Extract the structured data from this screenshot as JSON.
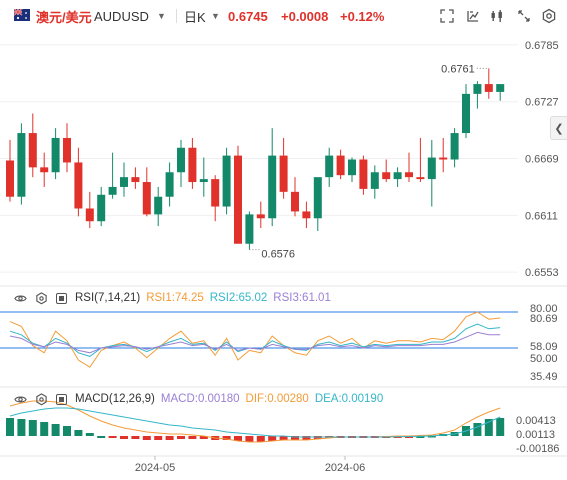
{
  "header": {
    "symbol_cn": "澳元/美元",
    "symbol_en": "AUDUSD",
    "period": "日K",
    "price": "0.6745",
    "change": "+0.0008",
    "change_pct": "+0.12%"
  },
  "colors": {
    "up": "#14896a",
    "down": "#e0312a",
    "rsi1": "#f39c38",
    "rsi2": "#35b6c9",
    "rsi3": "#9b7fd4",
    "macd_line": "#f39c38",
    "dif_line": "#35b6c9",
    "ref_line": "#2a7be4"
  },
  "icons": [
    "dropdown-caret-icon",
    "crosshair-icon",
    "drawing-icon",
    "indicator-icon",
    "fullscreen-icon",
    "settings-icon",
    "eye-icon",
    "gear-icon",
    "collapse-arrow-icon"
  ],
  "price_axis": {
    "labels": [
      "0.6785",
      "0.6727",
      "0.6669",
      "0.6611",
      "0.6553"
    ],
    "ylim": [
      0.6545,
      0.679
    ]
  },
  "annotations": {
    "high": "0.6761",
    "low": "0.6576"
  },
  "rsi": {
    "label": "RSI(7,14,21)",
    "rsi1_label": "RSI1:74.25",
    "rsi2_label": "RSI2:65.02",
    "rsi3_label": "RSI3:61.01",
    "axis_labels": [
      "80.00",
      "80.69",
      "58.09",
      "50.00",
      "35.49"
    ]
  },
  "macd": {
    "label": "MACD(12,26,9)",
    "macd_label": "MACD:0.00180",
    "dif_label": "DIF:0.00280",
    "dea_label": "DEA:0.00190",
    "axis_labels": [
      "0.00413",
      "0.00113",
      "-0.00186"
    ]
  },
  "time_axis": {
    "labels": [
      "2024-05",
      "2024-06"
    ]
  },
  "chart_data": {
    "type": "candlestick",
    "candles": [
      [
        0.6667,
        0.6688,
        0.6625,
        0.663
      ],
      [
        0.663,
        0.6705,
        0.6622,
        0.6695
      ],
      [
        0.6695,
        0.6715,
        0.665,
        0.666
      ],
      [
        0.666,
        0.6675,
        0.664,
        0.6655
      ],
      [
        0.6655,
        0.67,
        0.6648,
        0.669
      ],
      [
        0.669,
        0.6705,
        0.6655,
        0.6665
      ],
      [
        0.6665,
        0.668,
        0.661,
        0.6618
      ],
      [
        0.6618,
        0.6635,
        0.6598,
        0.6605
      ],
      [
        0.6605,
        0.664,
        0.66,
        0.6632
      ],
      [
        0.6632,
        0.6675,
        0.6628,
        0.664
      ],
      [
        0.664,
        0.6665,
        0.663,
        0.665
      ],
      [
        0.665,
        0.666,
        0.6638,
        0.6645
      ],
      [
        0.6645,
        0.666,
        0.661,
        0.6612
      ],
      [
        0.6612,
        0.664,
        0.66,
        0.663
      ],
      [
        0.663,
        0.6665,
        0.662,
        0.6655
      ],
      [
        0.6655,
        0.6688,
        0.664,
        0.668
      ],
      [
        0.668,
        0.669,
        0.6638,
        0.6645
      ],
      [
        0.6645,
        0.667,
        0.663,
        0.6648
      ],
      [
        0.6648,
        0.6652,
        0.6605,
        0.662
      ],
      [
        0.662,
        0.668,
        0.6612,
        0.6672
      ],
      [
        0.6672,
        0.6682,
        0.6598,
        0.6582
      ],
      [
        0.6582,
        0.6615,
        0.6576,
        0.6612
      ],
      [
        0.6612,
        0.6625,
        0.6598,
        0.6608
      ],
      [
        0.6608,
        0.67,
        0.66,
        0.6672
      ],
      [
        0.6672,
        0.669,
        0.6628,
        0.6635
      ],
      [
        0.6635,
        0.665,
        0.661,
        0.6615
      ],
      [
        0.6615,
        0.6625,
        0.6598,
        0.6608
      ],
      [
        0.6608,
        0.6648,
        0.6595,
        0.665
      ],
      [
        0.665,
        0.668,
        0.664,
        0.6672
      ],
      [
        0.6672,
        0.6678,
        0.6648,
        0.6652
      ],
      [
        0.6652,
        0.667,
        0.6645,
        0.6668
      ],
      [
        0.6668,
        0.6672,
        0.6632,
        0.6638
      ],
      [
        0.6638,
        0.6662,
        0.6628,
        0.6655
      ],
      [
        0.6655,
        0.6668,
        0.6645,
        0.6648
      ],
      [
        0.6648,
        0.666,
        0.664,
        0.6655
      ],
      [
        0.6655,
        0.6675,
        0.6645,
        0.665
      ],
      [
        0.665,
        0.669,
        0.6645,
        0.6648
      ],
      [
        0.6648,
        0.6688,
        0.662,
        0.667
      ],
      [
        0.667,
        0.669,
        0.6655,
        0.6668
      ],
      [
        0.6668,
        0.67,
        0.666,
        0.6695
      ],
      [
        0.6695,
        0.6745,
        0.669,
        0.6735
      ],
      [
        0.6735,
        0.6748,
        0.672,
        0.6745
      ],
      [
        0.6745,
        0.6761,
        0.673,
        0.6737
      ],
      [
        0.6737,
        0.6745,
        0.6728,
        0.6745
      ]
    ],
    "rsi1": [
      72,
      68,
      52,
      46,
      64,
      56,
      40,
      34,
      48,
      52,
      55,
      50,
      42,
      50,
      58,
      64,
      54,
      56,
      44,
      58,
      40,
      48,
      46,
      60,
      52,
      46,
      44,
      56,
      60,
      54,
      58,
      50,
      56,
      54,
      56,
      56,
      55,
      58,
      57,
      64,
      76,
      80,
      74,
      75
    ],
    "rsi2": [
      64,
      61,
      54,
      51,
      58,
      54,
      46,
      43,
      50,
      52,
      53,
      51,
      47,
      51,
      55,
      58,
      53,
      54,
      48,
      55,
      47,
      50,
      49,
      56,
      52,
      49,
      48,
      53,
      55,
      52,
      54,
      51,
      53,
      52,
      53,
      53,
      53,
      55,
      55,
      58,
      66,
      70,
      66,
      67
    ],
    "rsi3": [
      60,
      58,
      53,
      51,
      55,
      53,
      48,
      46,
      50,
      51,
      52,
      51,
      49,
      51,
      53,
      55,
      52,
      53,
      49,
      53,
      48,
      50,
      49,
      53,
      51,
      49,
      49,
      52,
      53,
      51,
      52,
      50,
      52,
      51,
      52,
      52,
      52,
      53,
      53,
      55,
      59,
      63,
      61,
      61
    ],
    "macd_hist": [
      0.0018,
      0.0017,
      0.0016,
      0.0014,
      0.0012,
      0.001,
      0.0006,
      0.0003,
      0.0,
      -0.0002,
      -0.0003,
      -0.0003,
      -0.0004,
      -0.0004,
      -0.0004,
      -0.0003,
      -0.0003,
      -0.0003,
      -0.0004,
      -0.0004,
      -0.0005,
      -0.0006,
      -0.0006,
      -0.0005,
      -0.0004,
      -0.0004,
      -0.0004,
      -0.0003,
      -0.0002,
      -0.0001,
      -5e-05,
      -0.0001,
      -0.0001,
      -5e-05,
      -3e-05,
      -2e-05,
      0.0,
      5e-05,
      0.0002,
      0.0004,
      0.001,
      0.0013,
      0.0017,
      0.0018
    ],
    "macd_dif": [
      0.003,
      0.0033,
      0.0035,
      0.0035,
      0.0034,
      0.0031,
      0.0026,
      0.002,
      0.0015,
      0.0011,
      0.0008,
      0.0006,
      0.0004,
      0.0003,
      0.0002,
      0.0002,
      0.0001,
      0.0,
      -0.0002,
      -0.0003,
      -0.0005,
      -0.0006,
      -0.0006,
      -0.0005,
      -0.0004,
      -0.0004,
      -0.0004,
      -0.0003,
      -0.0002,
      -0.0001,
      -0.0001,
      -0.0001,
      -0.0001,
      -5e-05,
      0.0,
      0.0,
      5e-05,
      0.0001,
      0.0003,
      0.0006,
      0.0013,
      0.0019,
      0.0024,
      0.0028
    ],
    "macd_dea": [
      0.002,
      0.0023,
      0.0025,
      0.0027,
      0.0028,
      0.0028,
      0.0027,
      0.0025,
      0.0023,
      0.0021,
      0.0019,
      0.0017,
      0.0015,
      0.0013,
      0.0011,
      0.001,
      0.0008,
      0.0007,
      0.0006,
      0.0004,
      0.0003,
      0.0002,
      0.0001,
      0.0,
      0.0,
      -0.0001,
      -0.0001,
      -0.0001,
      -0.0001,
      -0.0001,
      -0.0001,
      -0.0001,
      -0.0001,
      -0.0001,
      -8e-05,
      -5e-05,
      -3e-05,
      0.0,
      0.0001,
      0.0002,
      0.0005,
      0.0009,
      0.0014,
      0.0019
    ]
  }
}
